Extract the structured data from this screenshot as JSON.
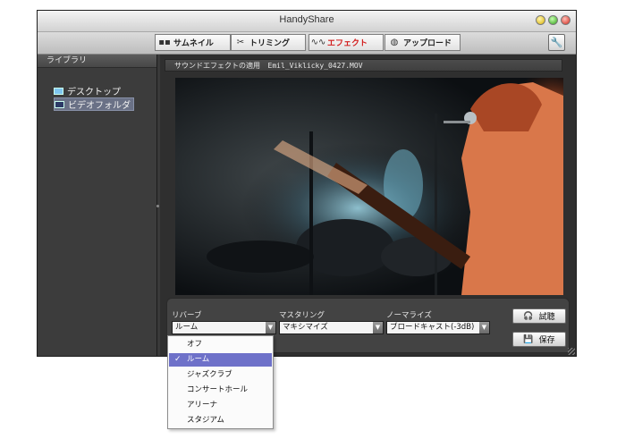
{
  "window": {
    "title": "HandyShare"
  },
  "toolbar": {
    "tabs": [
      {
        "label": "サムネイル",
        "icon": "thumbnail-grid-icon"
      },
      {
        "label": "トリミング",
        "icon": "film-cut-icon"
      },
      {
        "label": "エフェクト",
        "icon": "waveform-icon",
        "active": true
      },
      {
        "label": "アップロード",
        "icon": "globe-upload-icon"
      }
    ],
    "settings_icon": "wrench-icon"
  },
  "sidebar": {
    "header": "ライブラリ",
    "items": [
      {
        "label": "デスクトップ",
        "icon": "desktop-icon"
      },
      {
        "label": "ビデオフォルダ",
        "icon": "film-folder-icon",
        "selected": true
      }
    ]
  },
  "info_bar": {
    "label": "サウンドエフェクトの適用",
    "filename": "Emil_Viklicky_0427.MOV"
  },
  "effects": {
    "reverb": {
      "label": "リバーブ",
      "value": "ルーム"
    },
    "mastering": {
      "label": "マスタリング",
      "value": "マキシマイズ"
    },
    "normalize": {
      "label": "ノーマライズ",
      "value": "ブロードキャスト(-3dB)"
    },
    "listen_button": "試聴",
    "save_button": "保存"
  },
  "reverb_dropdown": {
    "options": [
      "オフ",
      "ルーム",
      "ジャズクラブ",
      "コンサートホール",
      "アリーナ",
      "スタジアム"
    ],
    "selected_index": 1
  },
  "colors": {
    "active_tab_text": "#d21c1c",
    "dropdown_highlight": "#6e71c9"
  }
}
